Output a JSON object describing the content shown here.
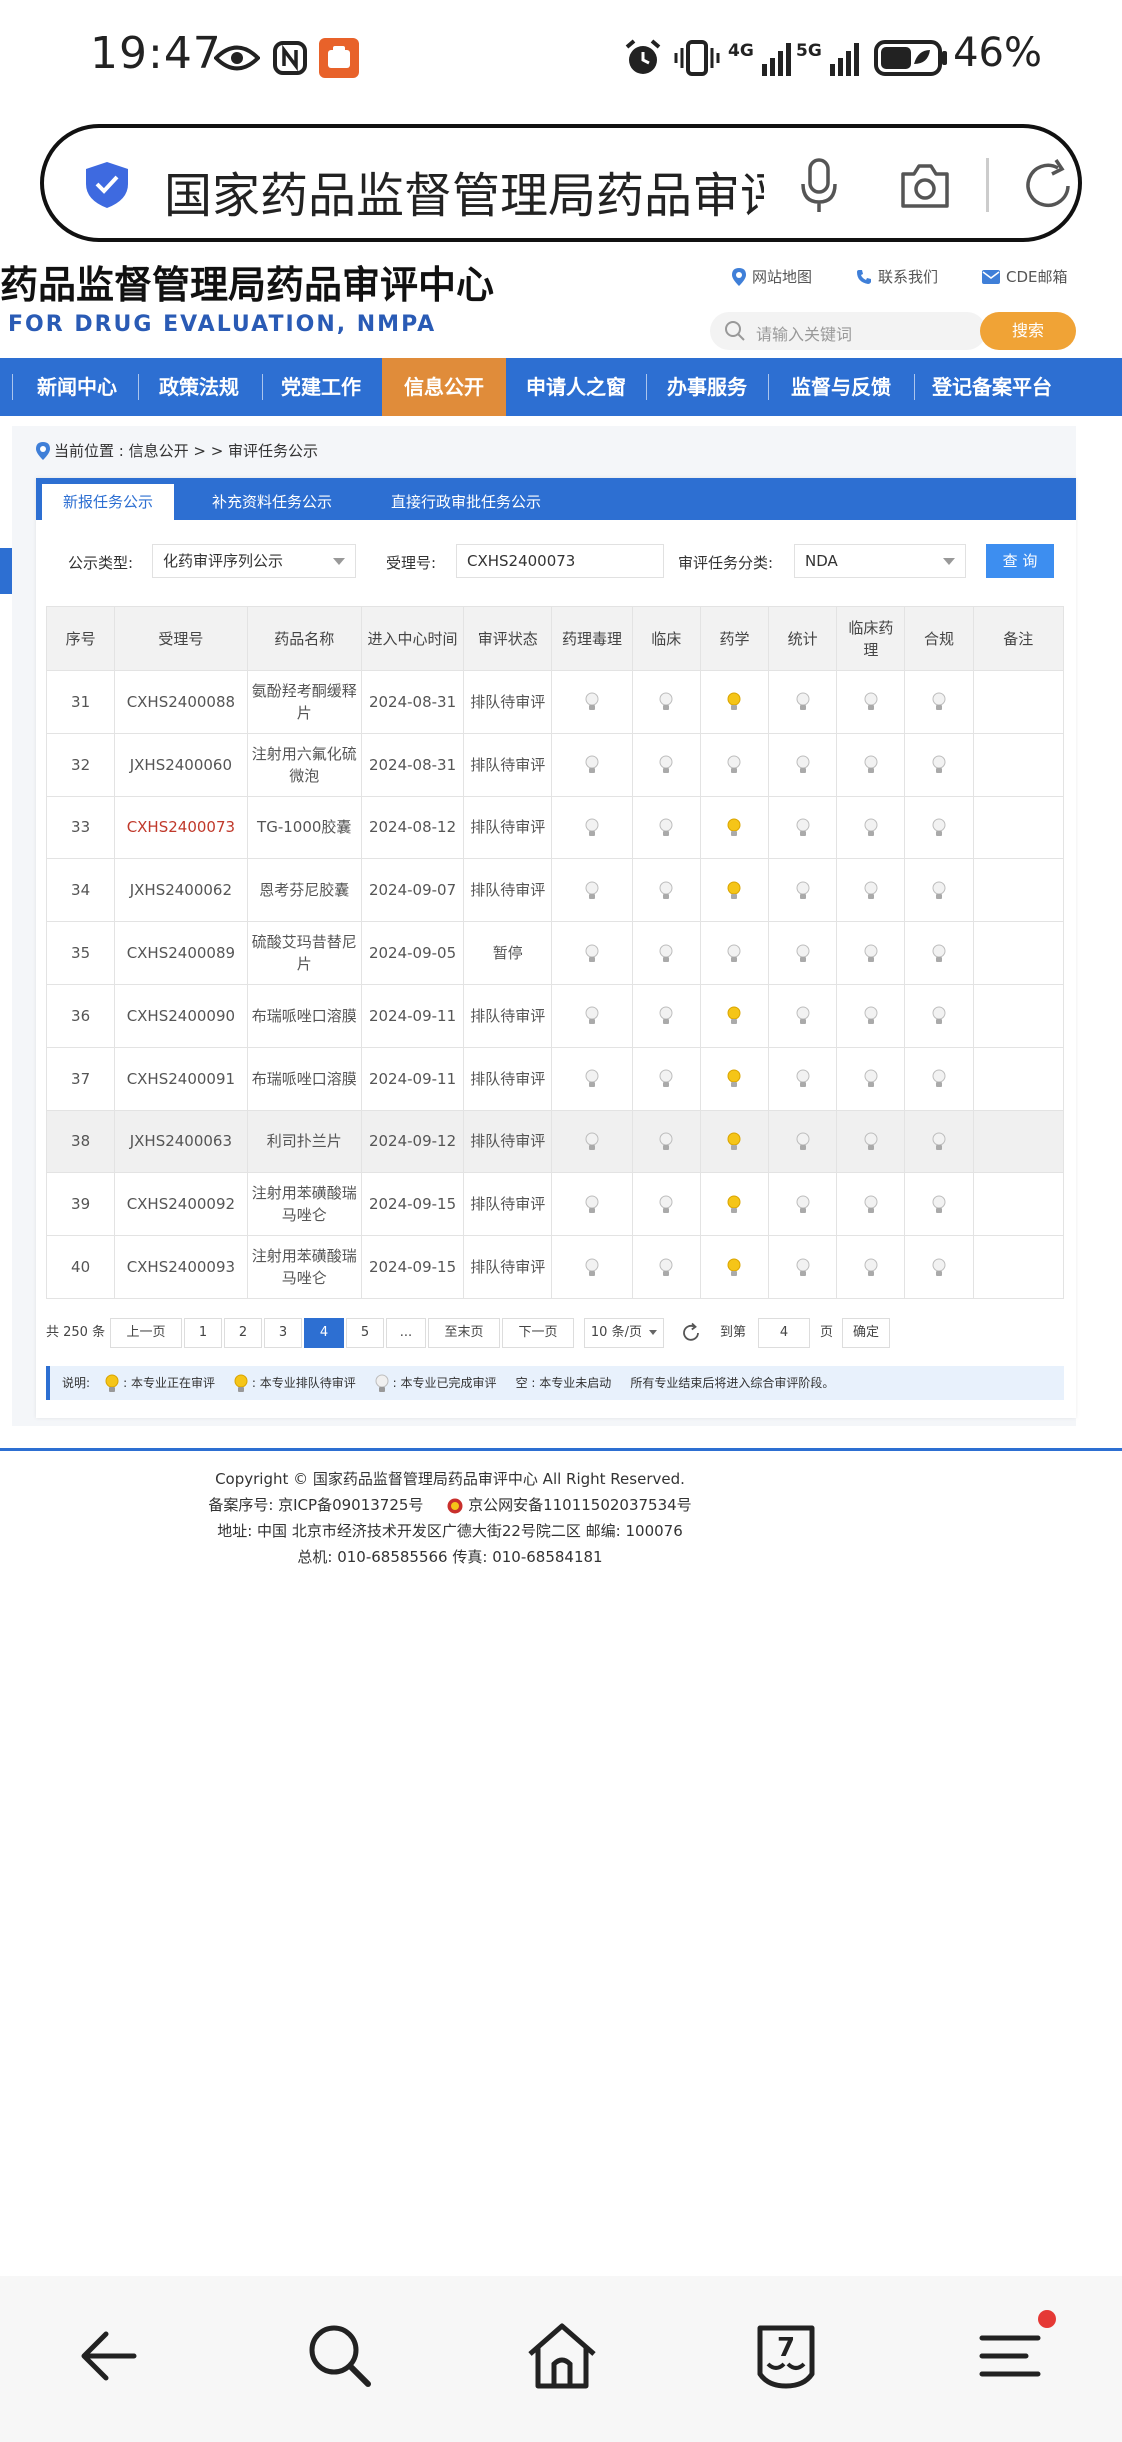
{
  "status_bar": {
    "time": "19:47",
    "battery": "46%",
    "net1": "4G",
    "net2": "5G"
  },
  "browser": {
    "url_text": "国家药品监督管理局药品审评中心",
    "tab_count": "7"
  },
  "site": {
    "title": "药品监督管理局药品审评中心",
    "subtitle": "FOR DRUG EVALUATION, NMPA",
    "links": [
      "网站地图",
      "联系我们",
      "CDE邮箱"
    ],
    "search_placeholder": "请输入关键词",
    "search_button": "搜索"
  },
  "nav": {
    "items": [
      "新闻中心",
      "政策法规",
      "党建工作",
      "信息公开",
      "申请人之窗",
      "办事服务",
      "监督与反馈",
      "登记备案平台"
    ],
    "active": "信息公开"
  },
  "breadcrumb": "当前位置 : 信息公开 > > 审评任务公示",
  "tabs": [
    "新报任务公示",
    "补充资料任务公示",
    "直接行政审批任务公示"
  ],
  "filters": {
    "type_label": "公示类型:",
    "type_value": "化药审评序列公示",
    "accept_label": "受理号:",
    "accept_value": "CXHS2400073",
    "category_label": "审评任务分类:",
    "category_value": "NDA",
    "query_button": "查 询"
  },
  "table": {
    "headers": [
      "序号",
      "受理号",
      "药品名称",
      "进入中心时间",
      "审评状态",
      "药理毒理",
      "临床",
      "药学",
      "统计",
      "临床药理",
      "合规",
      "备注"
    ],
    "rows": [
      {
        "no": "31",
        "id": "CXHS2400088",
        "name": "氨酚羟考酮缓释片",
        "date": "2024-08-31",
        "status": "排队待审评",
        "lights": [
          "done",
          "done",
          "active",
          "done",
          "done",
          "done"
        ]
      },
      {
        "no": "32",
        "id": "JXHS2400060",
        "name": "注射用六氟化硫微泡",
        "date": "2024-08-31",
        "status": "排队待审评",
        "lights": [
          "done",
          "done",
          "done",
          "done",
          "done",
          "done"
        ]
      },
      {
        "no": "33",
        "id": "CXHS2400073",
        "name": "TG-1000胶囊",
        "date": "2024-08-12",
        "status": "排队待审评",
        "lights": [
          "done",
          "done",
          "active",
          "done",
          "done",
          "done"
        ]
      },
      {
        "no": "34",
        "id": "JXHS2400062",
        "name": "恩考芬尼胶囊",
        "date": "2024-09-07",
        "status": "排队待审评",
        "lights": [
          "done",
          "done",
          "active",
          "done",
          "done",
          "done"
        ]
      },
      {
        "no": "35",
        "id": "CXHS2400089",
        "name": "硫酸艾玛昔替尼片",
        "date": "2024-09-05",
        "status": "暂停",
        "lights": [
          "done",
          "done",
          "done",
          "done",
          "done",
          "done"
        ]
      },
      {
        "no": "36",
        "id": "CXHS2400090",
        "name": "布瑞哌唑口溶膜",
        "date": "2024-09-11",
        "status": "排队待审评",
        "lights": [
          "done",
          "done",
          "active",
          "done",
          "done",
          "done"
        ]
      },
      {
        "no": "37",
        "id": "CXHS2400091",
        "name": "布瑞哌唑口溶膜",
        "date": "2024-09-11",
        "status": "排队待审评",
        "lights": [
          "done",
          "done",
          "active",
          "done",
          "done",
          "done"
        ]
      },
      {
        "no": "38",
        "id": "JXHS2400063",
        "name": "利司扑兰片",
        "date": "2024-09-12",
        "status": "排队待审评",
        "lights": [
          "done",
          "done",
          "active",
          "done",
          "done",
          "done"
        ]
      },
      {
        "no": "39",
        "id": "CXHS2400092",
        "name": "注射用苯磺酸瑞马唑仑",
        "date": "2024-09-15",
        "status": "排队待审评",
        "lights": [
          "done",
          "done",
          "active",
          "done",
          "done",
          "done"
        ]
      },
      {
        "no": "40",
        "id": "CXHS2400093",
        "name": "注射用苯磺酸瑞马唑仑",
        "date": "2024-09-15",
        "status": "排队待审评",
        "lights": [
          "done",
          "done",
          "active",
          "done",
          "done",
          "done"
        ]
      }
    ]
  },
  "pager": {
    "total": "共 250 条",
    "prev": "上一页",
    "pages": [
      "1",
      "2",
      "3",
      "4",
      "5",
      "..."
    ],
    "current": "4",
    "last": "至末页",
    "next": "下一页",
    "per_page": "10 条/页",
    "goto_label": "到第",
    "goto_value": "4",
    "page_unit": "页",
    "confirm": "确定"
  },
  "legend": {
    "prefix": "说明:",
    "active": ": 本专业正在审评",
    "queued": ": 本专业排队待审评",
    "done": ": 本专业已完成审评",
    "empty": "空 : 本专业未启动",
    "note": "所有专业结束后将进入综合审评阶段。"
  },
  "footer": {
    "copyright": "Copyright © 国家药品监督管理局药品审评中心   All Right Reserved.",
    "icp": "备案序号:  京ICP备09013725号",
    "police": "京公网安备11011502037534号",
    "address": "地址:  中国 北京市经济技术开发区广德大街22号院二区      邮编:  100076",
    "phone": "总机:  010-68585566      传真:  010-68584181"
  },
  "colors": {
    "brand_blue": "#2d6fd2",
    "active_orange": "#e08c3a",
    "search_orange": "#f0a336",
    "bulb_active": "#f5c518",
    "bulb_done": "#cfcfcf"
  }
}
